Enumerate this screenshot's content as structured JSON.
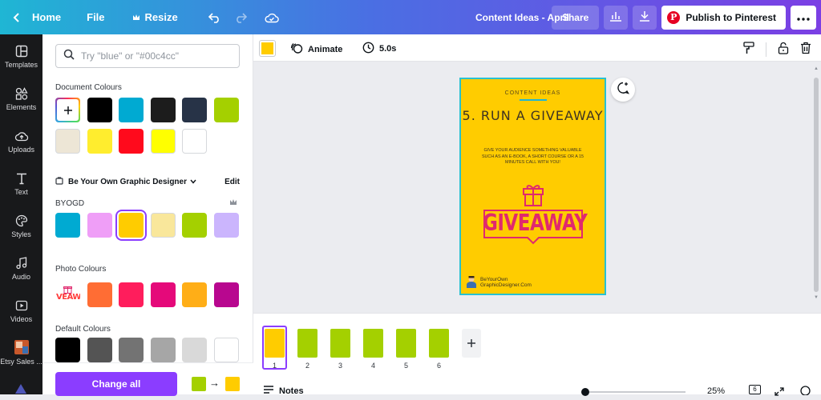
{
  "topbar": {
    "home_label": "Home",
    "file_label": "File",
    "resize_label": "Resize",
    "doc_title": "Content Ideas - April",
    "share_label": "Share",
    "pinterest_label": "Publish to Pinterest",
    "pinterest_logo": "P",
    "colors": {
      "gradient_start": "#1fb6d4",
      "gradient_end": "#7b3fe4"
    }
  },
  "sidenav": {
    "items": [
      {
        "label": "Templates",
        "icon": "templates-icon"
      },
      {
        "label": "Elements",
        "icon": "elements-icon"
      },
      {
        "label": "Uploads",
        "icon": "uploads-icon"
      },
      {
        "label": "Text",
        "icon": "text-icon"
      },
      {
        "label": "Styles",
        "icon": "styles-icon"
      },
      {
        "label": "Audio",
        "icon": "audio-icon"
      },
      {
        "label": "Videos",
        "icon": "videos-icon"
      },
      {
        "label": "Etsy Sales ...",
        "icon": "etsy-app-icon"
      }
    ]
  },
  "panel": {
    "search_placeholder": "Try \"blue\" or \"#00c4cc\"",
    "document_colours_title": "Document Colours",
    "document_colours": [
      "#000000",
      "#00aad2",
      "#1c1c1c",
      "#273347",
      "#a4d000",
      "#ede6d6",
      "#ffed2e",
      "#ff0a1c",
      "#ffff00",
      "#ffffff"
    ],
    "brand_kit_name": "Be Your Own Graphic Designer",
    "edit_label": "Edit",
    "brand_palette_name": "BYOGD",
    "brand_colours": [
      "#00aad2",
      "#ef9ef7",
      "#ffcc00",
      "#f9e79b",
      "#a4d000",
      "#cbb5fd"
    ],
    "photo_colours_title": "Photo Colours",
    "photo_thumb_text": "VEAW",
    "photo_colours": [
      "#ff6d34",
      "#ff1d5c",
      "#e5097a",
      "#ffae17",
      "#b8078f"
    ],
    "default_colours_title": "Default Colours",
    "default_colours": [
      "#000000",
      "#545454",
      "#737373",
      "#a6a6a6",
      "#d9d9d9",
      "#ffffff"
    ],
    "change_all_label": "Change all",
    "arrow": "→",
    "replace_from": "#a4d000",
    "replace_to": "#ffcc00"
  },
  "editor_toolbar": {
    "current_color": "#ffcc00",
    "animate_label": "Animate",
    "duration_label": "5.0s"
  },
  "page": {
    "small_title": "CONTENT IDEAS",
    "heading": "5. RUN A GIVEAWAY",
    "body": "GIVE YOUR AUDIENCE SOMETHING VALUABLE SUCH AS AN E-BOOK, A SHORT COURSE OR A 15 MINUTES CALL WITH YOU!",
    "badge_text": "GIVEAWAY",
    "footer_line1": "BeYourOwn",
    "footer_line2": "GraphicDesigner.Com",
    "background": "#ffcc00",
    "badge_color": "#e0296e"
  },
  "pages": {
    "numbers": [
      "1",
      "2",
      "3",
      "4",
      "5",
      "6"
    ],
    "colors": [
      "#ffcc00",
      "#a4d000",
      "#a4d000",
      "#a4d000",
      "#a4d000",
      "#a4d000"
    ],
    "selected": "1"
  },
  "bottom": {
    "notes_label": "Notes",
    "zoom_label": "25%",
    "zoom": 0.25,
    "page_count": "6"
  }
}
